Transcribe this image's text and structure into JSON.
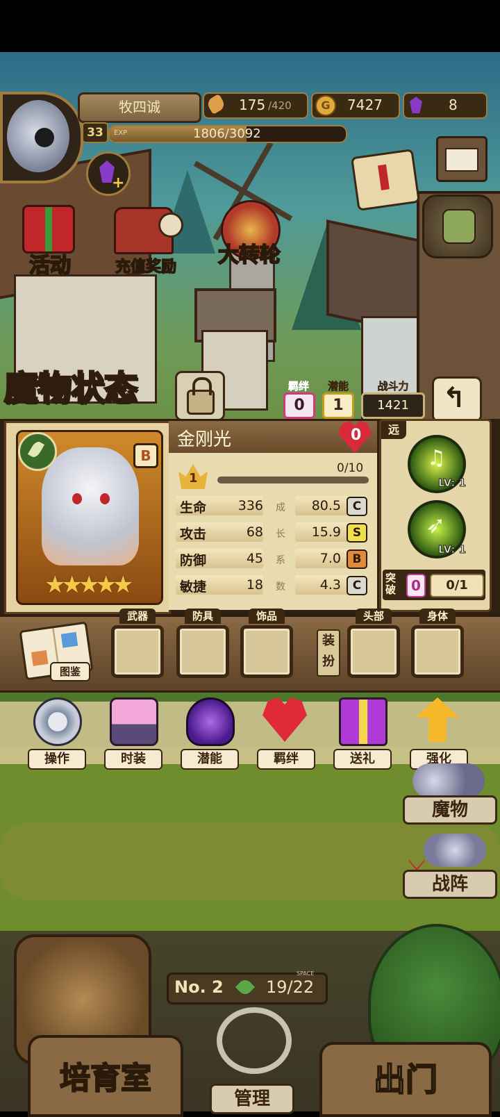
{
  "player": {
    "name": "牧四诚",
    "level": "33",
    "exp_label": "EXP",
    "exp": "1806/3092"
  },
  "resources": {
    "bread": "175",
    "bread_max": "/420",
    "gold": "7427",
    "gems": "8"
  },
  "town_buttons": {
    "event": "活动",
    "recharge": "充值奖励",
    "wheel": "大转轮"
  },
  "panel": {
    "title": "魔物状态",
    "bond_label": "羁绊",
    "bond_value": "0",
    "potential_label": "潜能",
    "potential_value": "1",
    "power_label": "战斗力",
    "power_value": "1421",
    "monster_name": "金刚光",
    "heart_value": "0",
    "rank_badge": "B",
    "star_level": "1",
    "exp_progress": "0/10",
    "range_tag": "远",
    "growth_chars": [
      "成",
      "长",
      "系",
      "数"
    ],
    "stats": [
      {
        "label": "生命",
        "value": "336",
        "growth": "80.5",
        "grade": "C"
      },
      {
        "label": "攻击",
        "value": "68",
        "growth": "15.9",
        "grade": "S"
      },
      {
        "label": "防御",
        "value": "45",
        "growth": "7.0",
        "grade": "B"
      },
      {
        "label": "敏捷",
        "value": "18",
        "growth": "4.3",
        "grade": "C"
      }
    ],
    "skills": [
      {
        "level": "LV: 1"
      },
      {
        "level": "LV: 1"
      }
    ],
    "breakthrough_label": "突破",
    "breakthrough_value": "0",
    "breakthrough_progress": "0/1"
  },
  "equipment": {
    "book_label": "图鉴",
    "dress_label": "装扮",
    "slots": [
      "武器",
      "防具",
      "饰品",
      "头部",
      "身体"
    ]
  },
  "menu": [
    "操作",
    "时装",
    "潜能",
    "羁绊",
    "送礼",
    "强化"
  ],
  "side": {
    "monster": "魔物",
    "formation": "战阵"
  },
  "bottom": {
    "no_label": "No. 2",
    "space_label": "SPACE",
    "capacity": "19/22",
    "nursery": "培育室",
    "manage": "管理",
    "go_out": "出门"
  },
  "colors": {
    "accent_gold": "#f5c94a",
    "panel_brown": "#3b2812",
    "parchment": "#e8d8a8",
    "grade_s": "#f0e04a",
    "grade_c": "#d9d9d0",
    "grade_b": "#e08a3a"
  }
}
